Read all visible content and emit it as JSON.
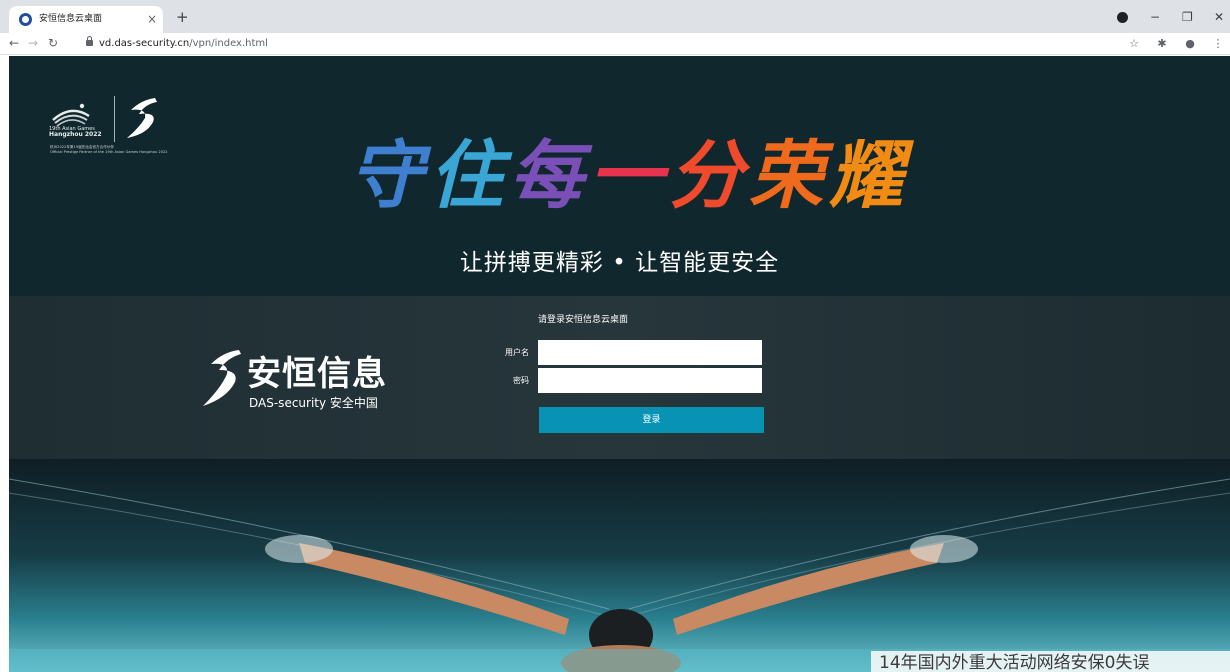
{
  "browser": {
    "tab_title": "安恒信息云桌面",
    "tab_close": "×",
    "new_tab": "+",
    "url_host": "vd.das-security.cn",
    "url_path": "/vpn/index.html",
    "icons": [
      "back-arrow-icon",
      "forward-arrow-icon",
      "reload-icon",
      "lock-icon",
      "star-icon",
      "extensions-icon",
      "profile-icon",
      "menu-icon"
    ]
  },
  "hero": {
    "games_name_line1": "19th Asian Games",
    "games_name_line2": "Hangzhou 2022",
    "games_sub_line1": "杭州2022年第19届亚运会官方合作伙伴",
    "games_sub_line2": "Official Prestige Partner of the 19th Asian Games Hangzhou 2022",
    "slogan_chars": [
      "守",
      "住",
      "每",
      "一",
      "分",
      "荣",
      "耀"
    ],
    "slogan_colors": [
      "#3f7fd0",
      "#3aa6d6",
      "#7a4fb8",
      "#e8334f",
      "#ef4a2b",
      "#f06a1d",
      "#f28b14"
    ],
    "tagline": "让拼搏更精彩 • 让智能更安全"
  },
  "brand": {
    "name": "安恒信息",
    "en": "DAS-security 安全中国"
  },
  "login": {
    "title": "请登录安恒信息云桌面",
    "username_label": "用户名",
    "password_label": "密码",
    "username_value": "",
    "password_value": "",
    "submit_label": "登录",
    "accent": "#0893b5"
  },
  "footer": {
    "caption": "14年国内外重大活动网络安保0失误"
  }
}
